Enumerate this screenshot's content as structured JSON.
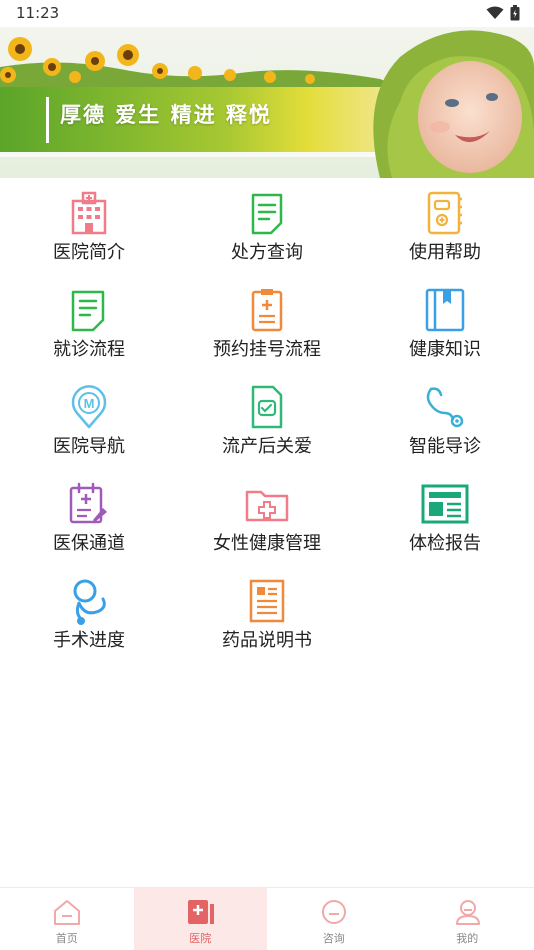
{
  "status_bar": {
    "time": "11:23"
  },
  "banner": {
    "slogan": "厚德 爱生 精进 释悦"
  },
  "menu": [
    {
      "label": "医院简介",
      "icon": "hospital-building-icon",
      "color": "#f07c8a"
    },
    {
      "label": "处方查询",
      "icon": "prescription-document-icon",
      "color": "#2fb84a"
    },
    {
      "label": "使用帮助",
      "icon": "help-notebook-icon",
      "color": "#f2b23c"
    },
    {
      "label": "就诊流程",
      "icon": "visit-process-document-icon",
      "color": "#2fb84a"
    },
    {
      "label": "预约挂号流程",
      "icon": "appointment-clipboard-icon",
      "color": "#f08a3a"
    },
    {
      "label": "健康知识",
      "icon": "health-book-icon",
      "color": "#3aa0e6"
    },
    {
      "label": "医院导航",
      "icon": "navigation-pin-icon",
      "color": "#5fc0e6"
    },
    {
      "label": "流产后关爱",
      "icon": "care-document-icon",
      "color": "#2fb878"
    },
    {
      "label": "智能导诊",
      "icon": "stethoscope-icon",
      "color": "#3ab0d6"
    },
    {
      "label": "医保通道",
      "icon": "insurance-calendar-icon",
      "color": "#a05ab8"
    },
    {
      "label": "女性健康管理",
      "icon": "medical-folder-icon",
      "color": "#f07c8a"
    },
    {
      "label": "体检报告",
      "icon": "report-newspaper-icon",
      "color": "#1aa87a"
    },
    {
      "label": "手术进度",
      "icon": "surgery-stethoscope-icon",
      "color": "#3aa0e6"
    },
    {
      "label": "药品说明书",
      "icon": "drug-manual-icon",
      "color": "#f08a3a"
    }
  ],
  "tabbar": {
    "tabs": [
      {
        "label": "首页",
        "icon": "home-icon",
        "active": false
      },
      {
        "label": "医院",
        "icon": "hospital-icon",
        "active": true
      },
      {
        "label": "咨询",
        "icon": "consult-icon",
        "active": false
      },
      {
        "label": "我的",
        "icon": "profile-icon",
        "active": false
      }
    ]
  }
}
